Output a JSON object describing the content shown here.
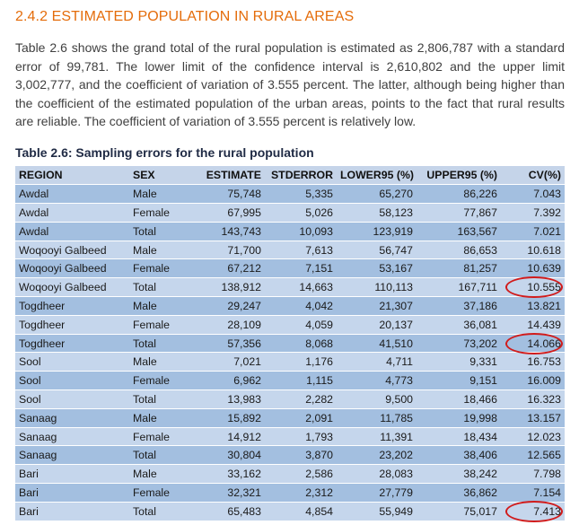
{
  "section_heading": "2.4.2 ESTIMATED POPULATION IN RURAL AREAS",
  "paragraph": "Table 2.6 shows the grand total of the rural population is estimated as 2,806,787 with a standard error of 99,781. The lower limit of the confidence interval is 2,610,802 and the upper limit 3,002,777, and the coefficient of variation of 3.555 percent. The latter, although being higher than the coefficient of the estimated population of the urban areas, points to the fact that rural results are reliable. The coefficient of variation of 3.555 percent is relatively low.",
  "table_title": "Table 2.6: Sampling errors for the rural population",
  "table": {
    "headers": [
      "REGION",
      "SEX",
      "ESTIMATE",
      "STDERROR",
      "LOWER95 (%)",
      "UPPER95 (%)",
      "CV(%)"
    ],
    "rows": [
      [
        "Awdal",
        "Male",
        "75,748",
        "5,335",
        "65,270",
        "86,226",
        "7.043"
      ],
      [
        "Awdal",
        "Female",
        "67,995",
        "5,026",
        "58,123",
        "77,867",
        "7.392"
      ],
      [
        "Awdal",
        "Total",
        "143,743",
        "10,093",
        "123,919",
        "163,567",
        "7.021"
      ],
      [
        "Woqooyi Galbeed",
        "Male",
        "71,700",
        "7,613",
        "56,747",
        "86,653",
        "10.618"
      ],
      [
        "Woqooyi Galbeed",
        "Female",
        "67,212",
        "7,151",
        "53,167",
        "81,257",
        "10.639"
      ],
      [
        "Woqooyi Galbeed",
        "Total",
        "138,912",
        "14,663",
        "110,113",
        "167,711",
        "10.555"
      ],
      [
        "Togdheer",
        "Male",
        "29,247",
        "4,042",
        "21,307",
        "37,186",
        "13.821"
      ],
      [
        "Togdheer",
        "Female",
        "28,109",
        "4,059",
        "20,137",
        "36,081",
        "14.439"
      ],
      [
        "Togdheer",
        "Total",
        "57,356",
        "8,068",
        "41,510",
        "73,202",
        "14.066"
      ],
      [
        "Sool",
        "Male",
        "7,021",
        "1,176",
        "4,711",
        "9,331",
        "16.753"
      ],
      [
        "Sool",
        "Female",
        "6,962",
        "1,115",
        "4,773",
        "9,151",
        "16.009"
      ],
      [
        "Sool",
        "Total",
        "13,983",
        "2,282",
        "9,500",
        "18,466",
        "16.323"
      ],
      [
        "Sanaag",
        "Male",
        "15,892",
        "2,091",
        "11,785",
        "19,998",
        "13.157"
      ],
      [
        "Sanaag",
        "Female",
        "14,912",
        "1,793",
        "11,391",
        "18,434",
        "12.023"
      ],
      [
        "Sanaag",
        "Total",
        "30,804",
        "3,870",
        "23,202",
        "38,406",
        "12.565"
      ],
      [
        "Bari",
        "Male",
        "33,162",
        "2,586",
        "28,083",
        "38,242",
        "7.798"
      ],
      [
        "Bari",
        "Female",
        "32,321",
        "2,312",
        "27,779",
        "36,862",
        "7.154"
      ],
      [
        "Bari",
        "Total",
        "65,483",
        "4,854",
        "55,949",
        "75,017",
        "7.413"
      ]
    ],
    "highlighted_rows": [
      5,
      8,
      17
    ]
  },
  "colors": {
    "heading": "#e46c0a",
    "header_fill": "#c5d4e9",
    "row_odd": "#a3bfe0",
    "row_even": "#c5d6ec",
    "highlight_circle": "#d11b1b"
  }
}
